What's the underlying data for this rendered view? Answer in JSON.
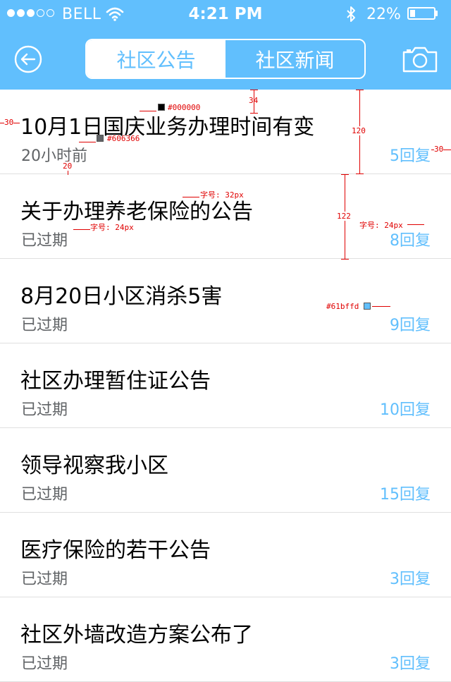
{
  "status_bar": {
    "carrier": "BELL",
    "time": "4:21 PM",
    "battery": "22%",
    "battery_level": 0.22,
    "signal_bars_filled": 3,
    "signal_bars_total": 5
  },
  "header": {
    "tabs": [
      {
        "label": "社区公告",
        "active": true
      },
      {
        "label": "社区新闻",
        "active": false
      }
    ],
    "back_icon": "back-arrow-icon",
    "camera_icon": "camera-icon"
  },
  "list": [
    {
      "title": "10月1日国庆业务办理时间有变",
      "time": "20小时前",
      "replies": "5回复"
    },
    {
      "title": "关于办理养老保险的公告",
      "time": "已过期",
      "replies": "8回复"
    },
    {
      "title": "8月20日小区消杀5害",
      "time": "已过期",
      "replies": "9回复"
    },
    {
      "title": "社区办理暂住证公告",
      "time": "已过期",
      "replies": "10回复"
    },
    {
      "title": "领导视察我小区",
      "time": "已过期",
      "replies": "15回复"
    },
    {
      "title": "医疗保险的若干公告",
      "time": "已过期",
      "replies": "3回复"
    },
    {
      "title": "社区外墙改造方案公布了",
      "time": "已过期",
      "replies": "3回复"
    }
  ],
  "annotations": {
    "title_color": "#000000",
    "time_color": "#606366",
    "replies_color": "#61bffd",
    "title_top": "34",
    "row_height_1": "120",
    "row_height_2": "122",
    "left_margin": "30",
    "right_margin": "30",
    "subtitle_gap": "20",
    "font_size_title": "字号: 32px",
    "font_size_sub_left": "字号: 24px",
    "font_size_sub_right": "字号: 24px"
  },
  "colors": {
    "accent": "#61bffd",
    "title": "#000000",
    "subtext": "#606366",
    "divider": "#e0e0e0"
  }
}
